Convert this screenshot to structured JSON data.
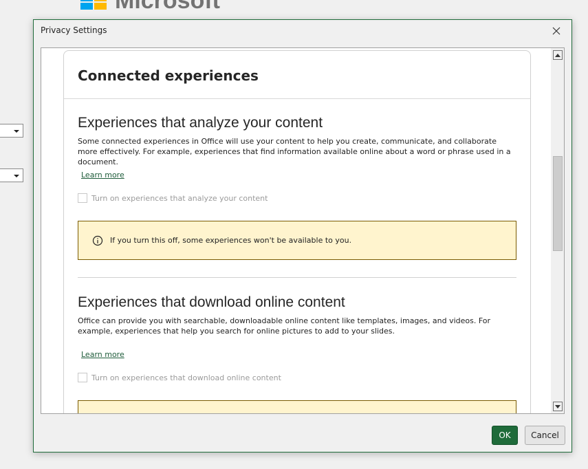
{
  "background": {
    "logo_text": "Microsoft"
  },
  "dialog": {
    "title": "Privacy Settings",
    "card_title": "Connected experiences",
    "sections": [
      {
        "heading": "Experiences that analyze your content",
        "description": "Some connected experiences in Office will use your content to help you create, communicate, and collaborate more effectively. For example, experiences that find information available online about a word or phrase used in a document.",
        "learn_more": "Learn more",
        "checkbox_label": "Turn on experiences that analyze your content",
        "checked": false,
        "warning": "If you turn this off, some experiences won't be available to you."
      },
      {
        "heading": "Experiences that download online content",
        "description": "Office can provide you with searchable, downloadable online content like templates, images, and videos. For example, experiences that help you search for online pictures to add to your slides.",
        "learn_more": "Learn more",
        "checkbox_label": "Turn on experiences that download online content",
        "checked": false
      }
    ],
    "buttons": {
      "ok": "OK",
      "cancel": "Cancel"
    }
  },
  "colors": {
    "accent": "#1f6b3a",
    "link": "#1e5c3a",
    "warning_bg": "#fff4ce",
    "warning_border": "#7a5a00"
  },
  "icons": {
    "close": "close-icon",
    "info": "info-icon",
    "scroll_up": "arrow-up-icon",
    "scroll_down": "arrow-down-icon",
    "dropdown": "chevron-down-icon"
  }
}
